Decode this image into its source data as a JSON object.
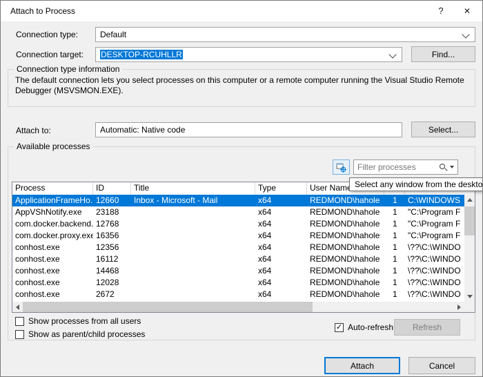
{
  "window": {
    "title": "Attach to Process",
    "help_glyph": "?",
    "close_glyph": "✕"
  },
  "connection": {
    "type_label": "Connection type:",
    "type_value": "Default",
    "target_label": "Connection target:",
    "target_value": "DESKTOP-RCUHLLR",
    "find_button": "Find...",
    "info_group_title": "Connection type information",
    "info_text": "The default connection lets you select processes on this computer or a remote computer running the Visual Studio Remote Debugger (MSVSMON.EXE)."
  },
  "attach": {
    "label": "Attach to:",
    "value": "Automatic: Native code",
    "select_button": "Select..."
  },
  "processes": {
    "group_title": "Available processes",
    "filter_placeholder": "Filter processes",
    "picker_tooltip": "Select any window from the desktop.",
    "columns": [
      "Process",
      "ID",
      "Title",
      "Type",
      "User Name",
      "",
      ""
    ],
    "rows": [
      {
        "process": "ApplicationFrameHo...",
        "id": "12660",
        "title": "Inbox - Microsoft - Mail",
        "type": "x64",
        "user": "REDMOND\\hahole",
        "session": "1",
        "path": "C:\\WINDOWS",
        "selected": true
      },
      {
        "process": "AppVShNotify.exe",
        "id": "23188",
        "title": "",
        "type": "x64",
        "user": "REDMOND\\hahole",
        "session": "1",
        "path": "\"C:\\Program F"
      },
      {
        "process": "com.docker.backend...",
        "id": "12768",
        "title": "",
        "type": "x64",
        "user": "REDMOND\\hahole",
        "session": "1",
        "path": "\"C:\\Program F"
      },
      {
        "process": "com.docker.proxy.exe",
        "id": "16356",
        "title": "",
        "type": "x64",
        "user": "REDMOND\\hahole",
        "session": "1",
        "path": "\"C:\\Program F"
      },
      {
        "process": "conhost.exe",
        "id": "12356",
        "title": "",
        "type": "x64",
        "user": "REDMOND\\hahole",
        "session": "1",
        "path": "\\??\\C:\\WINDO"
      },
      {
        "process": "conhost.exe",
        "id": "16112",
        "title": "",
        "type": "x64",
        "user": "REDMOND\\hahole",
        "session": "1",
        "path": "\\??\\C:\\WINDO"
      },
      {
        "process": "conhost.exe",
        "id": "14468",
        "title": "",
        "type": "x64",
        "user": "REDMOND\\hahole",
        "session": "1",
        "path": "\\??\\C:\\WINDO"
      },
      {
        "process": "conhost.exe",
        "id": "12028",
        "title": "",
        "type": "x64",
        "user": "REDMOND\\hahole",
        "session": "1",
        "path": "\\??\\C:\\WINDO"
      },
      {
        "process": "conhost.exe",
        "id": "2672",
        "title": "",
        "type": "x64",
        "user": "REDMOND\\hahole",
        "session": "1",
        "path": "\\??\\C:\\WINDO"
      }
    ],
    "footer": {
      "show_all_users": "Show processes from all users",
      "show_parent_child": "Show as parent/child processes",
      "auto_refresh": "Auto-refresh",
      "check_glyph": "✓",
      "refresh_button": "Refresh"
    }
  },
  "actions": {
    "attach_button": "Attach",
    "cancel_button": "Cancel"
  },
  "colors": {
    "selection": "#0078d7",
    "accent_border": "#0078d7"
  }
}
